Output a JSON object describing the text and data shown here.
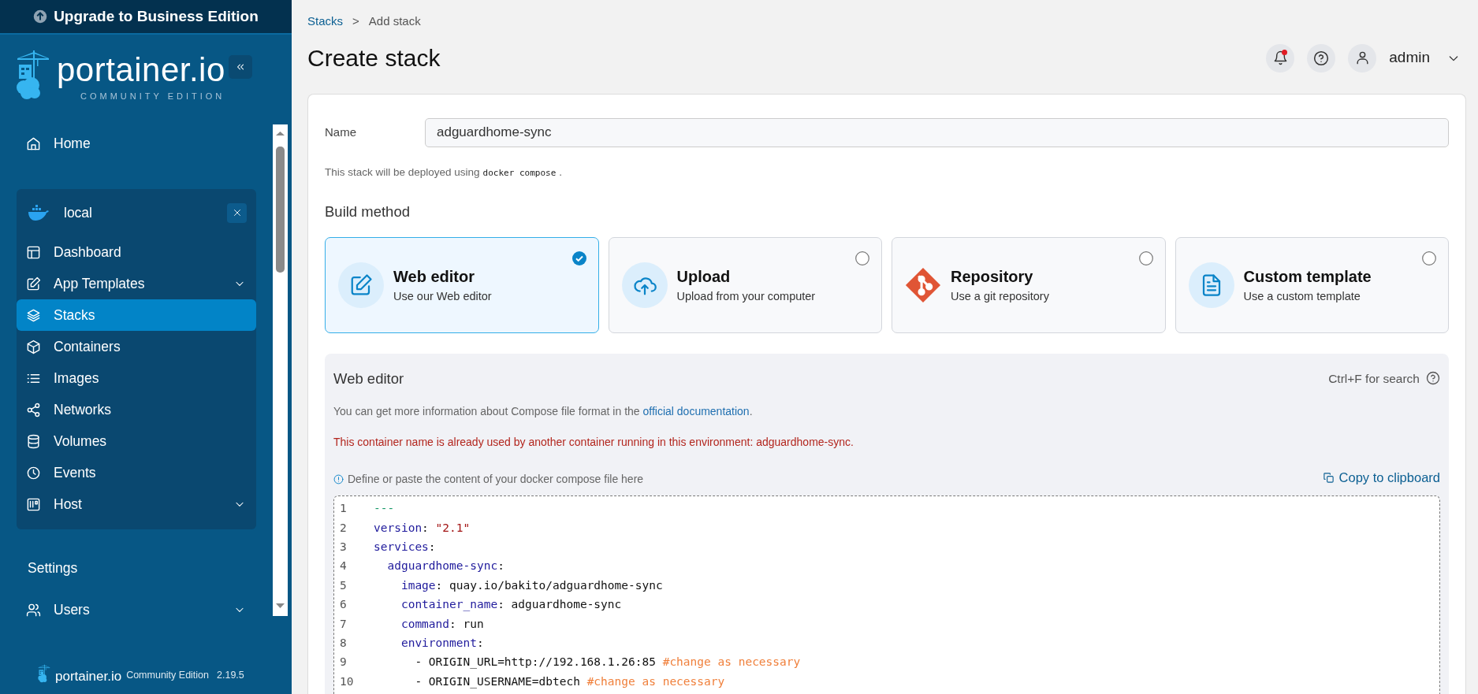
{
  "upgrade_banner": {
    "label": "Upgrade to Business Edition"
  },
  "logo": {
    "wordmark": "portainer.io",
    "edition": "COMMUNITY EDITION"
  },
  "sidebar": {
    "items": [
      {
        "label": "Home",
        "expandable": false,
        "selected": false
      }
    ],
    "environment": {
      "name": "local",
      "items": [
        {
          "label": "Dashboard",
          "expandable": false,
          "selected": false
        },
        {
          "label": "App Templates",
          "expandable": true,
          "selected": false
        },
        {
          "label": "Stacks",
          "expandable": false,
          "selected": true
        },
        {
          "label": "Containers",
          "expandable": false,
          "selected": false
        },
        {
          "label": "Images",
          "expandable": false,
          "selected": false
        },
        {
          "label": "Networks",
          "expandable": false,
          "selected": false
        },
        {
          "label": "Volumes",
          "expandable": false,
          "selected": false
        },
        {
          "label": "Events",
          "expandable": false,
          "selected": false
        },
        {
          "label": "Host",
          "expandable": true,
          "selected": false
        }
      ]
    },
    "settings_heading": "Settings",
    "settings_items": [
      {
        "label": "Users",
        "expandable": true,
        "selected": false
      }
    ],
    "footer": {
      "wordmark": "portainer.io",
      "edition": "Community Edition",
      "version": "2.19.5"
    }
  },
  "breadcrumb": [
    {
      "label": "Stacks",
      "kind": "link"
    },
    {
      "label": ">",
      "kind": "separator"
    },
    {
      "label": "Add stack",
      "kind": "current"
    }
  ],
  "title": "Create stack",
  "header": {
    "notification_unread": true,
    "user": "admin"
  },
  "form": {
    "name_label": "Name",
    "name_value": "adguardhome-sync",
    "deploy_note": {
      "before": "This stack will be deployed using",
      "code": "docker compose",
      "after": "."
    },
    "build_method_heading": "Build method",
    "build_methods": [
      {
        "title": "Web editor",
        "subtitle": "Use our Web editor",
        "selected": true
      },
      {
        "title": "Upload",
        "subtitle": "Upload from your computer",
        "selected": false
      },
      {
        "title": "Repository",
        "subtitle": "Use a git repository",
        "selected": false
      },
      {
        "title": "Custom template",
        "subtitle": "Use a custom template",
        "selected": false
      }
    ],
    "editor": {
      "title": "Web editor",
      "search_hint": "Ctrl+F for search",
      "info": {
        "before": "You can get more information about Compose file format in the",
        "link": "official documentation",
        "after": "."
      },
      "error": "This container name is already used by another container running in this environment: adguardhome-sync.",
      "hint": "Define or paste the content of your docker compose file here",
      "copy_button": "Copy to clipboard",
      "lines": [
        {
          "number": "1",
          "tokens": [
            {
              "kind": "doc",
              "text": "---"
            }
          ]
        },
        {
          "number": "2",
          "tokens": [
            {
              "kind": "key",
              "text": "version"
            },
            {
              "kind": "plain",
              "text": ": "
            },
            {
              "kind": "string",
              "text": "\"2.1\""
            }
          ]
        },
        {
          "number": "3",
          "tokens": [
            {
              "kind": "key",
              "text": "services"
            },
            {
              "kind": "plain",
              "text": ":"
            }
          ]
        },
        {
          "number": "4",
          "tokens": [
            {
              "kind": "key",
              "text": "  adguardhome-sync"
            },
            {
              "kind": "plain",
              "text": ":"
            }
          ]
        },
        {
          "number": "5",
          "tokens": [
            {
              "kind": "key",
              "text": "    image"
            },
            {
              "kind": "plain",
              "text": ": quay.io/bakito/adguardhome-sync"
            }
          ]
        },
        {
          "number": "6",
          "tokens": [
            {
              "kind": "key",
              "text": "    container_name"
            },
            {
              "kind": "plain",
              "text": ": adguardhome-sync"
            }
          ]
        },
        {
          "number": "7",
          "tokens": [
            {
              "kind": "key",
              "text": "    command"
            },
            {
              "kind": "plain",
              "text": ": run"
            }
          ]
        },
        {
          "number": "8",
          "tokens": [
            {
              "kind": "key",
              "text": "    environment"
            },
            {
              "kind": "plain",
              "text": ":"
            }
          ]
        },
        {
          "number": "9",
          "tokens": [
            {
              "kind": "plain",
              "text": "      - ORIGIN_URL=http://192.168.1.26:85 "
            },
            {
              "kind": "comment",
              "text": "#change as necessary"
            }
          ]
        },
        {
          "number": "10",
          "tokens": [
            {
              "kind": "plain",
              "text": "      - ORIGIN_USERNAME=dbtech "
            },
            {
              "kind": "comment",
              "text": "#change as necessary"
            }
          ]
        }
      ]
    }
  }
}
